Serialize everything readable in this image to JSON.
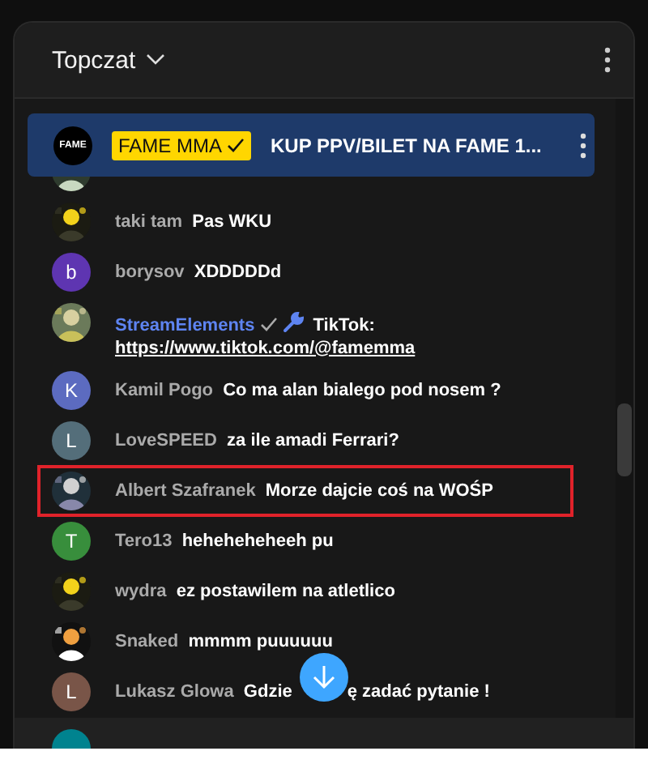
{
  "header": {
    "title": "Topczat"
  },
  "pinned": {
    "avatar_text": "FAME",
    "author": "FAME MMA",
    "verified": true,
    "message": "KUP PPV/BILET NA FAME 1..."
  },
  "messages": [
    {
      "highlighted": false
    },
    {
      "author": "taki tam",
      "message": "Pas WKU",
      "highlighted": false
    },
    {
      "avatar": {
        "kind": "letter",
        "letter": "b",
        "color": "#5e35b1"
      },
      "author": "borysov",
      "message": "XDDDDDd",
      "highlighted": false
    },
    {
      "author": "StreamElements",
      "kind": "moderator",
      "verified": true,
      "message": "TikTok:",
      "link": "https://www.tiktok.com/@famemma",
      "highlighted": false
    },
    {
      "avatar": {
        "kind": "letter",
        "letter": "K",
        "color": "#5c6bc0"
      },
      "author": "Kamil Pogo",
      "message": "Co ma alan bialego pod nosem ?",
      "highlighted": false
    },
    {
      "avatar": {
        "kind": "letter",
        "letter": "L",
        "color": "#546e7a"
      },
      "author": "LoveSPEED",
      "message": "za ile amadi Ferrari?",
      "highlighted": false
    },
    {
      "author": "Albert Szafranek",
      "message": "Morze dajcie coś na WOŚP",
      "highlighted": true
    },
    {
      "avatar": {
        "kind": "letter",
        "letter": "T",
        "color": "#388e3c"
      },
      "author": "Tero13",
      "message": "heheheheheeh pu",
      "highlighted": false
    },
    {
      "author": "wydra",
      "message": "ez postawilem na atletlico",
      "highlighted": false
    },
    {
      "author": "Snaked",
      "message": "mmmm puuuuuu",
      "highlighted": false
    },
    {
      "avatar": {
        "kind": "letter",
        "letter": "L",
        "color": "#795548"
      },
      "author": "Lukasz Glowa",
      "message": "Gdzie",
      "message_continued": "ę zadać pytanie !",
      "highlighted": false
    }
  ],
  "footer": {
    "avatar": {
      "kind": "letter",
      "color": "#00838f"
    }
  }
}
